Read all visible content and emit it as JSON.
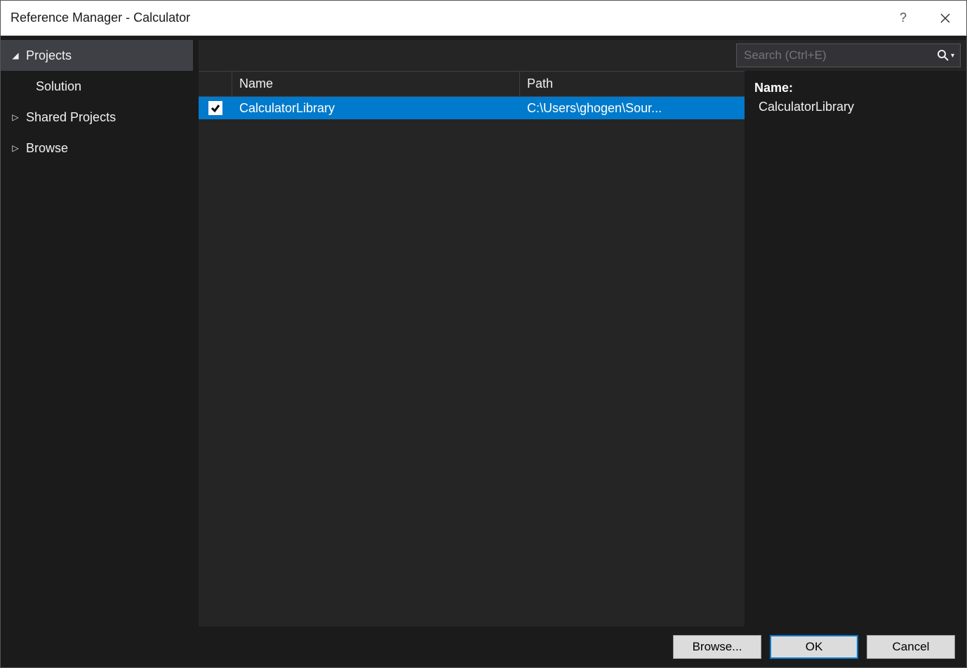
{
  "titlebar": {
    "title": "Reference Manager - Calculator",
    "help_char": "?",
    "close_label": "Close"
  },
  "sidebar": {
    "items": [
      {
        "label": "Projects",
        "expanded": true,
        "subitems": [
          {
            "label": "Solution"
          }
        ]
      },
      {
        "label": "Shared Projects",
        "expanded": false
      },
      {
        "label": "Browse",
        "expanded": false
      }
    ]
  },
  "search": {
    "placeholder": "Search (Ctrl+E)"
  },
  "table": {
    "columns": {
      "name": "Name",
      "path": "Path"
    },
    "rows": [
      {
        "checked": true,
        "name": "CalculatorLibrary",
        "path": "C:\\Users\\ghogen\\Sour..."
      }
    ]
  },
  "details": {
    "name_label": "Name:",
    "name_value": "CalculatorLibrary"
  },
  "footer": {
    "browse": "Browse...",
    "ok": "OK",
    "cancel": "Cancel"
  }
}
